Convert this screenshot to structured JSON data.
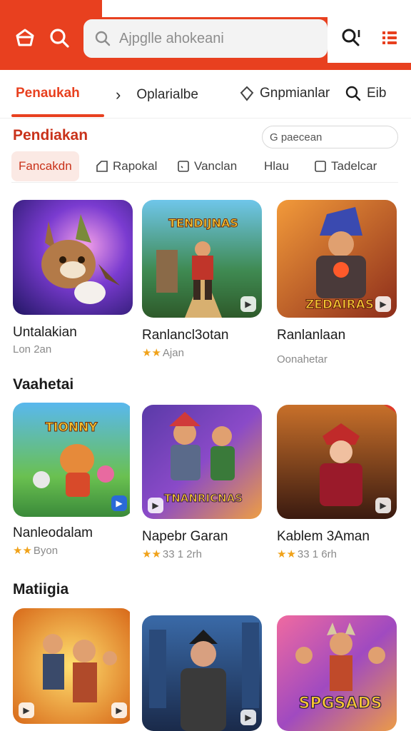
{
  "search": {
    "placeholder": "Ajpglle ahokeani"
  },
  "tabs": [
    {
      "label": "Penaukah"
    },
    {
      "label": "Oplarialbe"
    },
    {
      "label": "Gnpmianlar"
    },
    {
      "label": "Eib"
    }
  ],
  "filter": {
    "title": "Pendiakan",
    "search_placeholder": "G paecean",
    "chips": [
      "Fancakdn",
      "Rapokal",
      "Vanclan",
      "Hlau",
      "Tadelcar"
    ]
  },
  "sections": [
    {
      "title": "",
      "games": [
        {
          "title": "Untalakian",
          "sub": "Lon 2an",
          "stars": 0
        },
        {
          "title": "Ranlancl3otan",
          "sub": "Ajan",
          "stars": 2
        },
        {
          "title": "Ranlanlaan",
          "sub": "Oonahetar",
          "stars": 0
        }
      ]
    },
    {
      "title": "Vaahetai",
      "games": [
        {
          "title": "Nanleodalam",
          "sub": "Byon",
          "stars": 2
        },
        {
          "title": "Napebr Garan",
          "sub": "33 1 2rh",
          "stars": 2
        },
        {
          "title": "Kablem 3Aman",
          "sub": "33 1 6rh",
          "stars": 2
        }
      ]
    },
    {
      "title": "Matiigia",
      "games": [
        {
          "title": "",
          "sub": "",
          "stars": 0
        },
        {
          "title": "",
          "sub": "",
          "stars": 0
        },
        {
          "title": "",
          "sub": "",
          "stars": 0
        }
      ]
    }
  ],
  "art_text": {
    "g2": "TENDIJNAS",
    "g3": "ZEDAIRAS",
    "g4": "TIONNY",
    "g5": "TNANRICNAS",
    "g9": "SPGSADS"
  },
  "colors": {
    "brand": "#e8401f",
    "star": "#f0a21a"
  }
}
